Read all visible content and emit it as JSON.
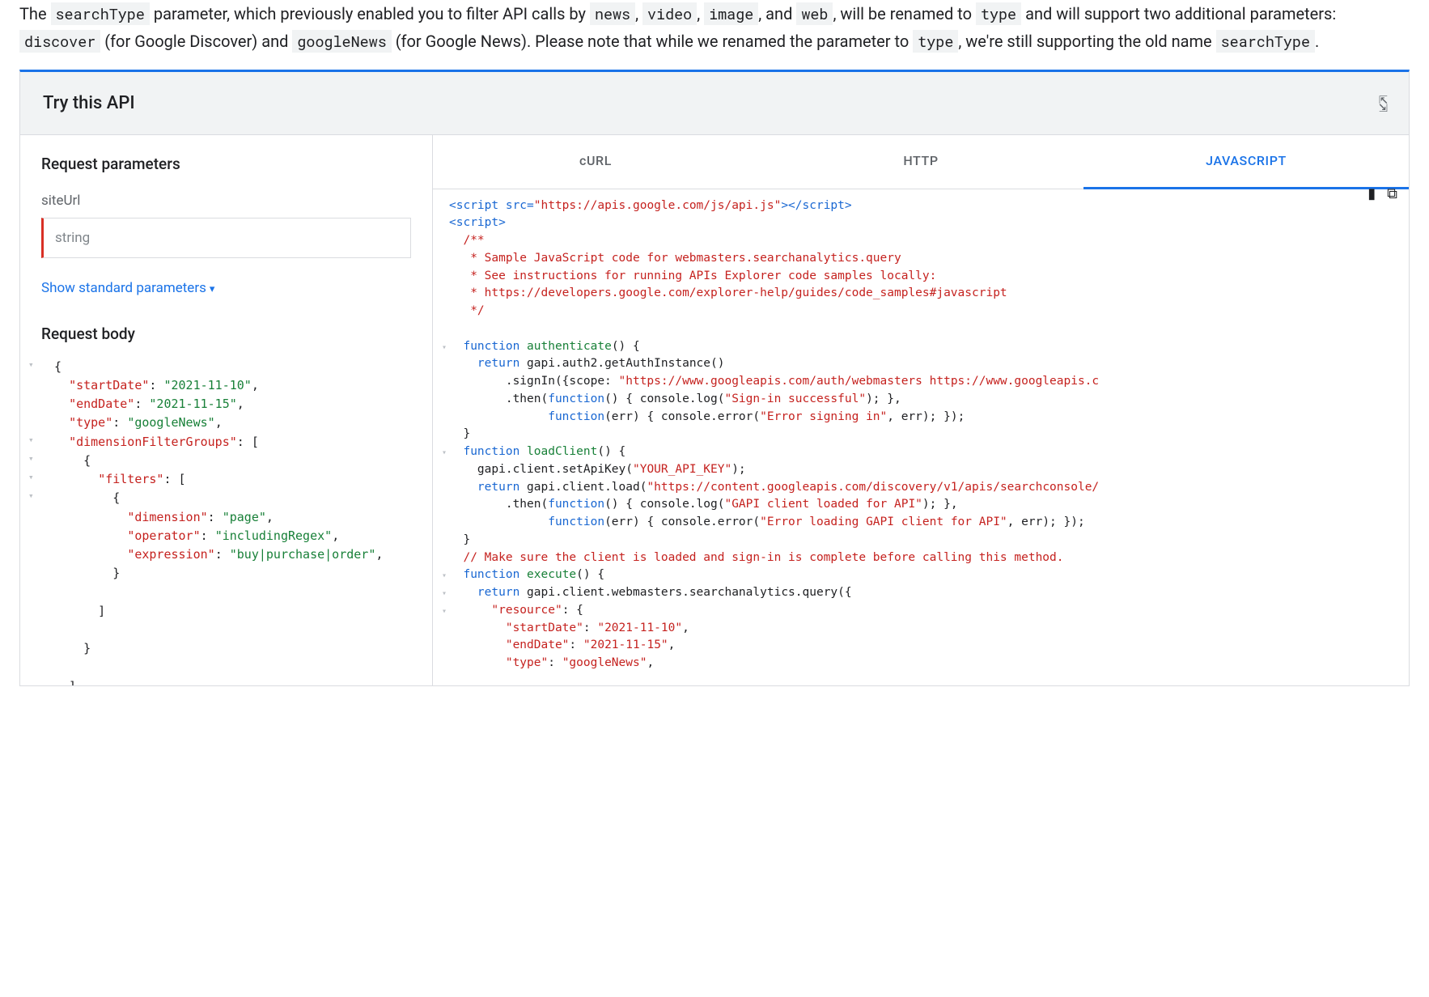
{
  "intro": {
    "p1a": "The ",
    "c1": "searchType",
    "p1b": " parameter, which previously enabled you to filter API calls by ",
    "c2": "news",
    "p1c": ", ",
    "c3": "video",
    "p1d": ", ",
    "c4": "image",
    "p1e": ", and ",
    "c5": "web",
    "p1f": ", will be renamed to ",
    "c6": "type",
    "p1g": " and will support two additional parameters: ",
    "c7": "discover",
    "p1h": " (for Google Discover) and ",
    "c8": "googleNews",
    "p1i": " (for Google News). Please note that while we renamed the parameter to ",
    "c9": "type",
    "p1j": ", we're still supporting the old name ",
    "c10": "searchType",
    "p1k": "."
  },
  "panel": {
    "title": "Try this API"
  },
  "left": {
    "request_params": "Request parameters",
    "siteUrl": "siteUrl",
    "string": "string",
    "show_std": "Show standard parameters",
    "request_body": "Request body",
    "json": {
      "startDate_k": "\"startDate\"",
      "startDate_v": "\"2021-11-10\"",
      "endDate_k": "\"endDate\"",
      "endDate_v": "\"2021-11-15\"",
      "type_k": "\"type\"",
      "type_v": "\"googleNews\"",
      "dfg_k": "\"dimensionFilterGroups\"",
      "filters_k": "\"filters\"",
      "dimension_k": "\"dimension\"",
      "dimension_v": "\"page\"",
      "operator_k": "\"operator\"",
      "operator_v": "\"includingRegex\"",
      "expression_k": "\"expression\"",
      "expression_v": "\"buy|purchase|order\""
    }
  },
  "tabs": {
    "curl": "cURL",
    "http": "HTTP",
    "js": "JAVASCRIPT"
  },
  "code": {
    "l01a": "<script src=",
    "l01b": "\"https://apis.google.com/js/api.js\"",
    "l01c": "></script>",
    "l02": "<script>",
    "l03": "  /**",
    "l04": "   * Sample JavaScript code for webmasters.searchanalytics.query",
    "l05": "   * See instructions for running APIs Explorer code samples locally:",
    "l06": "   * https://developers.google.com/explorer-help/guides/code_samples#javascript",
    "l07": "   */",
    "l09a": "  function",
    "l09b": " authenticate",
    "l09c": "() {",
    "l10a": "    return",
    "l10b": " gapi.auth2.getAuthInstance()",
    "l11a": "        .signIn({scope: ",
    "l11b": "\"https://www.googleapis.com/auth/webmasters https://www.googleapis.c",
    "l12a": "        .then(",
    "l12b": "function",
    "l12c": "() { console.log(",
    "l12d": "\"Sign-in successful\"",
    "l12e": "); },",
    "l13a": "              ",
    "l13b": "function",
    "l13c": "(err) { console.error(",
    "l13d": "\"Error signing in\"",
    "l13e": ", err); });",
    "l14": "  }",
    "l15a": "  function",
    "l15b": " loadClient",
    "l15c": "() {",
    "l16a": "    gapi.client.setApiKey(",
    "l16b": "\"YOUR_API_KEY\"",
    "l16c": ");",
    "l17a": "    return",
    "l17b": " gapi.client.load(",
    "l17c": "\"https://content.googleapis.com/discovery/v1/apis/searchconsole/",
    "l18a": "        .then(",
    "l18b": "function",
    "l18c": "() { console.log(",
    "l18d": "\"GAPI client loaded for API\"",
    "l18e": "); },",
    "l19a": "              ",
    "l19b": "function",
    "l19c": "(err) { console.error(",
    "l19d": "\"Error loading GAPI client for API\"",
    "l19e": ", err); });",
    "l20": "  }",
    "l21": "  // Make sure the client is loaded and sign-in is complete before calling this method.",
    "l22a": "  function",
    "l22b": " execute",
    "l22c": "() {",
    "l23a": "    return",
    "l23b": " gapi.client.webmasters.searchanalytics.query({",
    "l24a": "      ",
    "l24b": "\"resource\"",
    "l24c": ": {",
    "l25a": "        ",
    "l25b": "\"startDate\"",
    "l25c": ": ",
    "l25d": "\"2021-11-10\"",
    "l25e": ",",
    "l26a": "        ",
    "l26b": "\"endDate\"",
    "l26c": ": ",
    "l26d": "\"2021-11-15\"",
    "l26e": ",",
    "l27a": "        ",
    "l27b": "\"type\"",
    "l27c": ": ",
    "l27d": "\"googleNews\"",
    "l27e": ","
  }
}
